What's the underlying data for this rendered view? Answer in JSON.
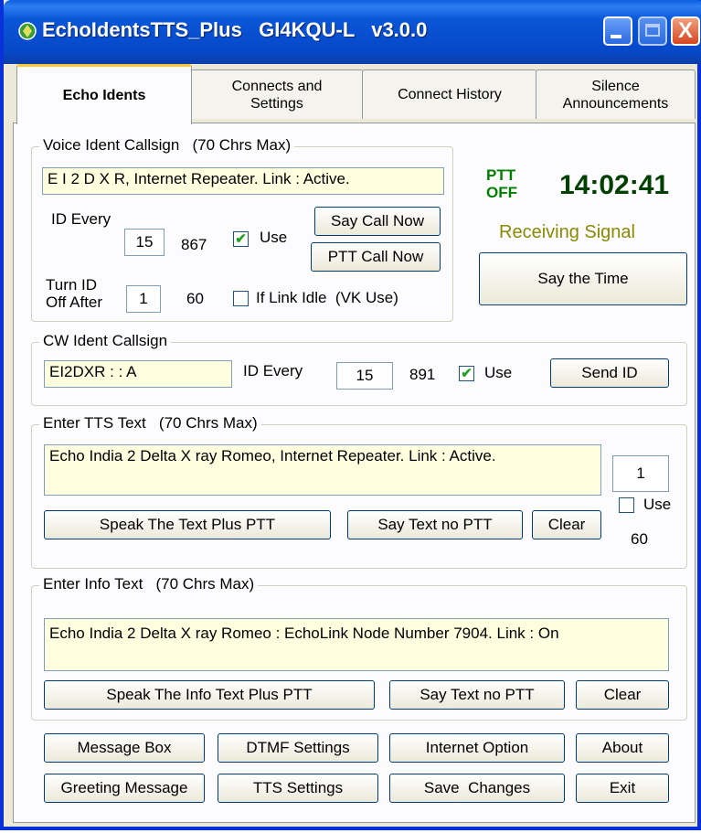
{
  "window": {
    "title": "EchoIdentsTTS_Plus   GI4KQU-L   v3.0.0",
    "close_glyph": "X"
  },
  "tabs": [
    {
      "label": "Echo Idents",
      "active": true
    },
    {
      "label": "Connects and Settings"
    },
    {
      "label": "Connect History"
    },
    {
      "label": "Silence Announcements"
    }
  ],
  "voice_ident": {
    "legend": "Voice Ident Callsign   (70 Chrs Max)",
    "callsign": "E I 2 D X R, Internet Repeater. Link : Active.",
    "id_every_label": "ID Every",
    "id_every_value": "15",
    "counter": "867",
    "use_label": "Use",
    "use_checked": true,
    "say_call_now": "Say Call Now",
    "ptt_call_now": "PTT Call Now",
    "turn_id_off_after_label": "Turn ID\nOff After",
    "turn_id_off_value": "1",
    "turn_off_counter": "60",
    "if_link_idle_label": "If Link Idle  (VK Use)",
    "if_link_idle_checked": false
  },
  "status": {
    "ptt_state": "PTT\nOFF",
    "ptt_color": "#008000",
    "clock": "14:02:41",
    "clock_color": "#004000",
    "receiving": "Receiving Signal",
    "receiving_color": "#8a8a00",
    "say_time": "Say the Time"
  },
  "cw_ident": {
    "legend": "CW Ident Callsign",
    "callsign": "EI2DXR : : A",
    "id_every_label": "ID Every",
    "id_every_value": "15",
    "counter": "891",
    "use_label": "Use",
    "use_checked": true,
    "send_id": "Send ID"
  },
  "tts_text": {
    "legend": "Enter TTS Text   (70 Chrs Max)",
    "text": "Echo India 2 Delta X ray Romeo, Internet Repeater. Link : Active.",
    "side_value": "1",
    "use_label": "Use",
    "use_checked": false,
    "side_counter": "60",
    "speak_plus_ptt": "Speak The Text Plus PTT",
    "say_no_ptt": "Say Text no PTT",
    "clear": "Clear"
  },
  "info_text": {
    "legend": "Enter Info Text   (70 Chrs Max)",
    "text": "Echo India 2 Delta X ray Romeo : EchoLink Node Number 7904. Link : On",
    "speak_plus_ptt": "Speak The Info Text Plus PTT",
    "say_no_ptt": "Say Text no PTT",
    "clear": "Clear"
  },
  "footer": {
    "message_box": "Message Box",
    "dtmf_settings": "DTMF Settings",
    "internet_option": "Internet Option",
    "about": "About",
    "greeting_message": "Greeting Message",
    "tts_settings": "TTS Settings",
    "save_changes": "Save  Changes",
    "exit": "Exit"
  }
}
